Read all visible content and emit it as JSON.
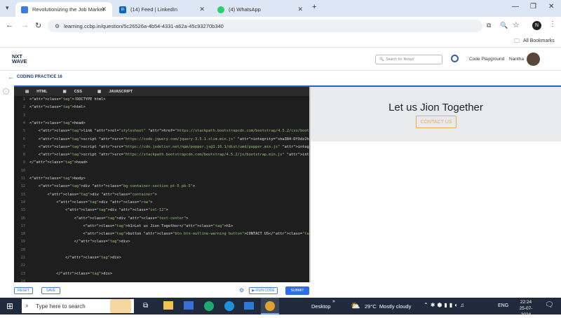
{
  "browser": {
    "tabs": [
      {
        "title": "Revolutionizing the Job Market",
        "fav_color": "#3d7be0",
        "active": true
      },
      {
        "title": "(14) Feed | LinkedIn",
        "fav_color": "#0a66c2",
        "active": false
      },
      {
        "title": "(4) WhatsApp",
        "fav_color": "#25d366",
        "active": false
      }
    ],
    "url": "learning.ccbp.in/question/5c26526a-4b54-4331-a62a-45c93270b340",
    "bookmarks_label": "All Bookmarks",
    "profile_initial": "N"
  },
  "site": {
    "logo_line1": "NXT",
    "logo_line2": "WAVE",
    "search_placeholder": "Search for 'Arrays'",
    "code_playground": "Code Playground",
    "user_name": "Nantha",
    "back_label": "CODING PRACTICE 16"
  },
  "editor": {
    "tabs": [
      "HTML",
      "CSS",
      "JAVASCRIPT"
    ],
    "lines": [
      "<!DOCTYPE html>",
      "<html>",
      "",
      "<head>",
      "    <link rel=\"stylesheet\" href=\"https://stackpath.bootstrapcdn.com/bootstrap/4.5.2/css/bootstrap.min.css\" integr",
      "    <script src=\"https://code.jquery.com/jquery-3.5.1.slim.min.js\" integrity=\"sha384-DfXdz2htPH0lsSSs5nCTpuj/zy4C",
      "    <script src=\"https://cdn.jsdelivr.net/npm/popper.js@1.16.1/dist/umd/popper.min.js\" integrity=\"sha384-9/reFTGA",
      "    <script src=\"https://stackpath.bootstrapcdn.com/bootstrap/4.5.2/js/bootstrap.min.js\" integrity=\"sha384-B4gt1j",
      "</head>",
      "",
      "<body>",
      "    <div class=\"bg-container-section pt-5 pb-5\">",
      "        <div class=\"container\">",
      "            <div class=\"row\">",
      "                <div class=\"col-12\">",
      "                    <div class=\"text-center\">",
      "                        <h1>Let us Jion Together</h1>",
      "                        <button class=\"btn btn-outline-warning button\">CONTACT US</button>",
      "                    </div>",
      "",
      "                </div>",
      "",
      "            </div>",
      "24"
    ],
    "reset": "RESET",
    "save": "SAVE",
    "run_code": "RUN CODE",
    "submit": "SUBMIT"
  },
  "preview": {
    "heading": "Let us Jion Together",
    "button": "CONTACT US"
  },
  "taskbar": {
    "search_placeholder": "Type here to search",
    "desktop": "Desktop",
    "weather": "29°C  Mostly cloudy",
    "lang": "ENG",
    "time": "22:24",
    "date": "25-07-2024"
  }
}
